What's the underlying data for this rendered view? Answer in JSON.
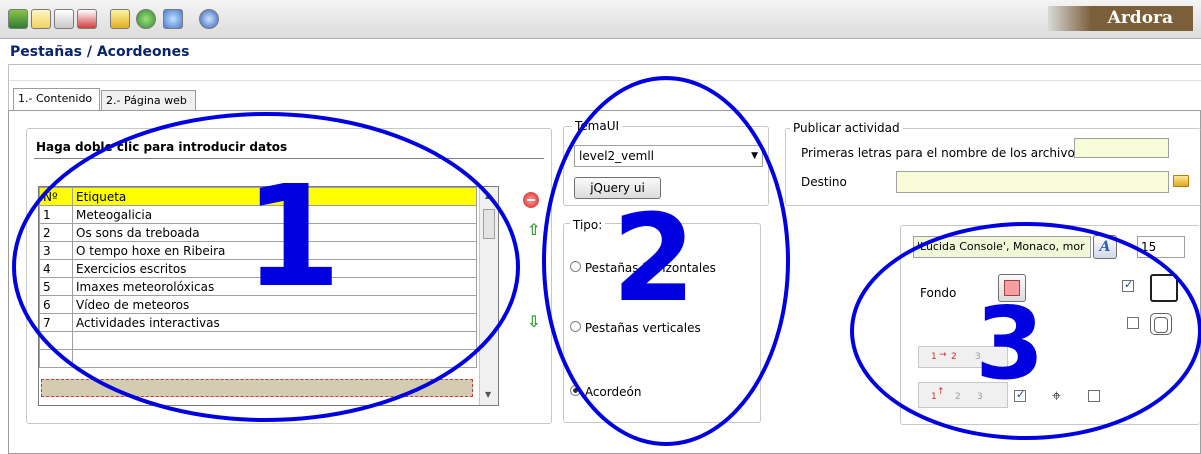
{
  "app": {
    "brand": "Ardora"
  },
  "page": {
    "title": "Pestañas / Acordeones"
  },
  "tabs": [
    {
      "label": "1.- Contenido",
      "active": true
    },
    {
      "label": "2.- Página web",
      "active": false
    }
  ],
  "toolbar": {
    "icons": [
      "exit-icon",
      "new-icon",
      "save-icon",
      "save-as-icon",
      "options-icon",
      "web-icon",
      "preview-icon",
      "help-icon"
    ]
  },
  "data_panel": {
    "heading": "Haga doble clic para introducir datos",
    "columns": [
      "Nº",
      "Etiqueta"
    ],
    "rows": [
      {
        "n": "1",
        "label": "Meteogalicia"
      },
      {
        "n": "2",
        "label": "Os sons da treboada"
      },
      {
        "n": "3",
        "label": "O tempo hoxe en Ribeira"
      },
      {
        "n": "4",
        "label": "Exercicios escritos"
      },
      {
        "n": "5",
        "label": "Imaxes meteorolóxicas"
      },
      {
        "n": "6",
        "label": "Vídeo de meteoros"
      },
      {
        "n": "7",
        "label": "Actividades interactivas"
      }
    ]
  },
  "theme": {
    "group_label": "TemaUI",
    "selected": "level2_vemll",
    "button_label": "jQuery ui"
  },
  "type_group": {
    "label": "Tipo:",
    "options": [
      {
        "label": "Pestañas horizontales",
        "selected": false
      },
      {
        "label": "Pestañas verticales",
        "selected": false
      },
      {
        "label": "Acordeón",
        "selected": true
      }
    ]
  },
  "publish": {
    "group_label": "Publicar actividad",
    "prefix_label": "Primeras letras para el nombre de los archivos",
    "prefix_value": "",
    "dest_label": "Destino",
    "dest_value": ""
  },
  "style": {
    "font_value": "'Lucida Console', Monaco, mor",
    "font_size": "15",
    "bg_label": "Fondo",
    "bg_color": "#f4a0a0",
    "check_top": true,
    "check_mid": false,
    "check_bottom1": true,
    "check_bottom2": false,
    "step_labels": [
      "1",
      "2",
      "3"
    ]
  },
  "annotations": {
    "n1": "1",
    "n2": "2",
    "n3": "3"
  },
  "colors": {
    "annotation": "#0000e0",
    "header": "#ffff00",
    "title": "#0a246a",
    "brand_bg": "#7b5f3a"
  }
}
